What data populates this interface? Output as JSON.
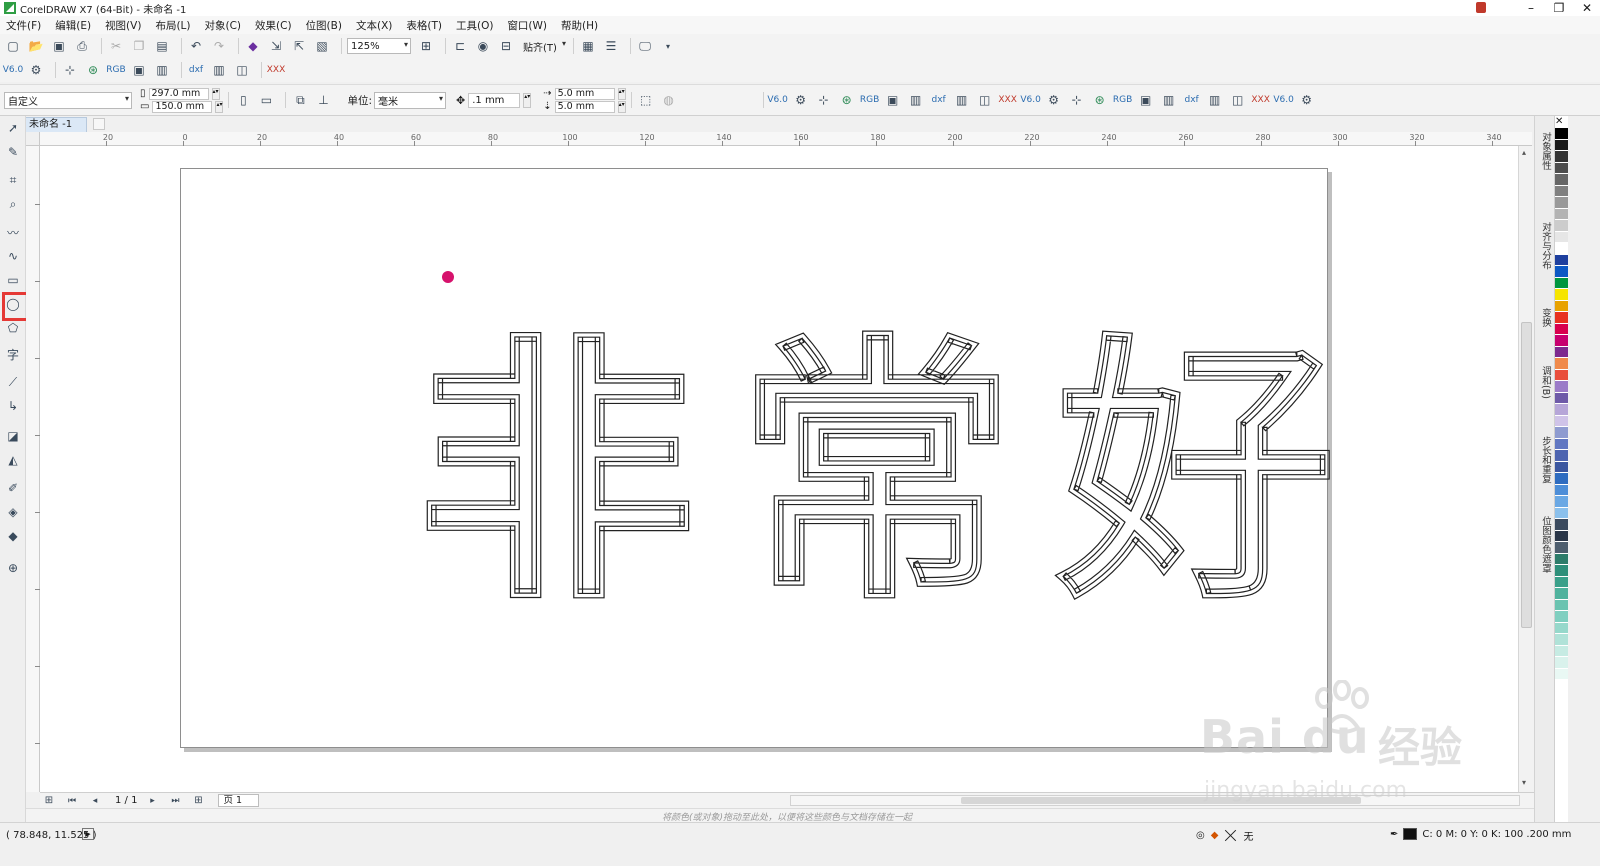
{
  "window": {
    "title": "CorelDRAW X7 (64-Bit) - 未命名 -1",
    "controls": [
      "–",
      "❐",
      "✕"
    ]
  },
  "menu": [
    "文件(F)",
    "编辑(E)",
    "视图(V)",
    "布局(L)",
    "对象(C)",
    "效果(C)",
    "位图(B)",
    "文本(X)",
    "表格(T)",
    "工具(O)",
    "窗口(W)",
    "帮助(H)"
  ],
  "standard_toolbar": {
    "zoom": "125%",
    "snap_label": "贴齐(T)"
  },
  "property_bar": {
    "page_preset": "自定义",
    "page_width": "297.0 mm",
    "page_height": "150.0 mm",
    "unit_label": "单位:",
    "unit_value": "毫米",
    "nudge": ".1 mm",
    "dup_x": "5.0 mm",
    "dup_y": "5.0 mm"
  },
  "document_tab": "未命名 -1",
  "rulers": {
    "h_labels": [
      "20",
      "0",
      "20",
      "40",
      "60",
      "80",
      "100",
      "120",
      "140",
      "160",
      "180",
      "200",
      "220",
      "240",
      "260",
      "280",
      "300",
      "320",
      "340"
    ]
  },
  "canvas": {
    "text_art": "非常好",
    "dot_color": "#d6126c"
  },
  "page_nav": {
    "counter": "1 / 1",
    "page_tab": "页 1"
  },
  "color_hint": "将颜色(或对象)拖动至此处，以便将这些颜色与文档存储在一起",
  "dockers": [
    "对象属性",
    "对齐与分布",
    "变换",
    "调和(B)",
    "步长和重复",
    "位图颜色遮罩"
  ],
  "palette_colors": [
    "#000000",
    "#1a1a1a",
    "#333333",
    "#4d4d4d",
    "#666666",
    "#808080",
    "#999999",
    "#b3b3b3",
    "#cccccc",
    "#e6e6e6",
    "#ffffff",
    "#1e3f9e",
    "#0c58c4",
    "#00963f",
    "#f6e500",
    "#e8a200",
    "#e8321f",
    "#d8004e",
    "#c7006f",
    "#7e2a8f",
    "#f08a4b",
    "#e94e3c",
    "#9b7bc8",
    "#6e5aa8",
    "#b6a6d8",
    "#cfc3e8",
    "#8e9bd0",
    "#6177c2",
    "#4d64b0",
    "#3a56a0",
    "#2e6cc0",
    "#4d8ed8",
    "#6aa8e4",
    "#8bc0ec",
    "#3b4a5e",
    "#2a3648",
    "#4e5e6e",
    "#2d7c6a",
    "#2e8f7a",
    "#3aa08a",
    "#4fb29d",
    "#6ac3b0",
    "#7fcfc0",
    "#96d8cb",
    "#b0e2d8",
    "#c6ebe3",
    "#d9f2ec",
    "#e9f8f4"
  ],
  "status": {
    "coords": "( 78.848, 11.525 )",
    "fill_label": "无",
    "outline_info": "C: 0 M: 0 Y: 0 K: 100  .200 mm"
  },
  "watermark": {
    "logo": "Bai  du",
    "cn": "经验",
    "url": "jingyan.baidu.com"
  }
}
